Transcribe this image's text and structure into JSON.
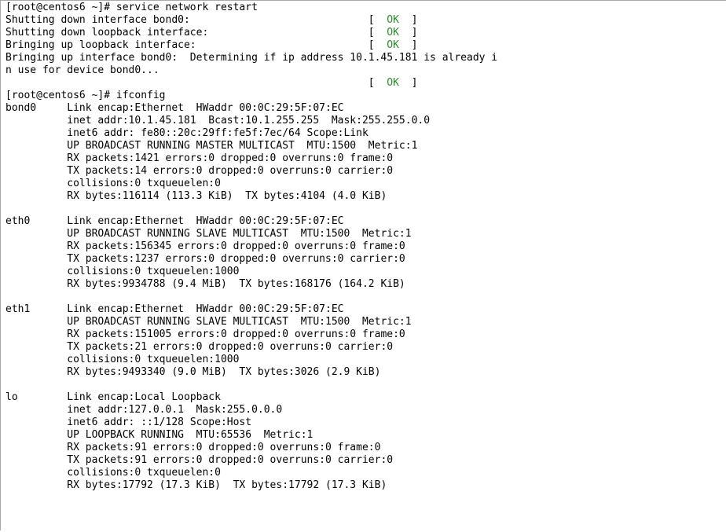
{
  "lines": {
    "0": {
      "prompt": "[root@centos6 ~]#",
      "cmd": "service network restart"
    },
    "1": {
      "text": "Shutting down interface bond0:                             ",
      "status": "OK"
    },
    "2": {
      "text": "Shutting down loopback interface:                          ",
      "status": "OK"
    },
    "3": {
      "text": "Bringing up loopback interface:                            ",
      "status": "OK"
    },
    "4": {
      "text": "Bringing up interface bond0:  Determining if ip address 10.1.45.181 is already i"
    },
    "5": {
      "text": "n use for device bond0..."
    },
    "6": {
      "text": "                                                           ",
      "status": "OK"
    },
    "7": {
      "prompt": "[root@centos6 ~]#",
      "cmd": "ifconfig"
    }
  },
  "ifaces": {
    "bond0": {
      "name": "bond0",
      "l0": "Link encap:Ethernet  HWaddr 00:0C:29:5F:07:EC",
      "l1": "inet addr:10.1.45.181  Bcast:10.1.255.255  Mask:255.255.0.0",
      "l2": "inet6 addr: fe80::20c:29ff:fe5f:7ec/64 Scope:Link",
      "l3": "UP BROADCAST RUNNING MASTER MULTICAST  MTU:1500  Metric:1",
      "l4": "RX packets:1421 errors:0 dropped:0 overruns:0 frame:0",
      "l5": "TX packets:14 errors:0 dropped:0 overruns:0 carrier:0",
      "l6": "collisions:0 txqueuelen:0",
      "l7": "RX bytes:116114 (113.3 KiB)  TX bytes:4104 (4.0 KiB)"
    },
    "eth0": {
      "name": "eth0",
      "l0": "Link encap:Ethernet  HWaddr 00:0C:29:5F:07:EC",
      "l1": "UP BROADCAST RUNNING SLAVE MULTICAST  MTU:1500  Metric:1",
      "l2": "RX packets:156345 errors:0 dropped:0 overruns:0 frame:0",
      "l3": "TX packets:1237 errors:0 dropped:0 overruns:0 carrier:0",
      "l4": "collisions:0 txqueuelen:1000",
      "l5": "RX bytes:9934788 (9.4 MiB)  TX bytes:168176 (164.2 KiB)"
    },
    "eth1": {
      "name": "eth1",
      "l0": "Link encap:Ethernet  HWaddr 00:0C:29:5F:07:EC",
      "l1": "UP BROADCAST RUNNING SLAVE MULTICAST  MTU:1500  Metric:1",
      "l2": "RX packets:151005 errors:0 dropped:0 overruns:0 frame:0",
      "l3": "TX packets:21 errors:0 dropped:0 overruns:0 carrier:0",
      "l4": "collisions:0 txqueuelen:1000",
      "l5": "RX bytes:9493340 (9.0 MiB)  TX bytes:3026 (2.9 KiB)"
    },
    "lo": {
      "name": "lo",
      "l0": "Link encap:Local Loopback",
      "l1": "inet addr:127.0.0.1  Mask:255.0.0.0",
      "l2": "inet6 addr: ::1/128 Scope:Host",
      "l3": "UP LOOPBACK RUNNING  MTU:65536  Metric:1",
      "l4": "RX packets:91 errors:0 dropped:0 overruns:0 frame:0",
      "l5": "TX packets:91 errors:0 dropped:0 overruns:0 carrier:0",
      "l6": "collisions:0 txqueuelen:0",
      "l7": "RX bytes:17792 (17.3 KiB)  TX bytes:17792 (17.3 KiB)"
    }
  }
}
